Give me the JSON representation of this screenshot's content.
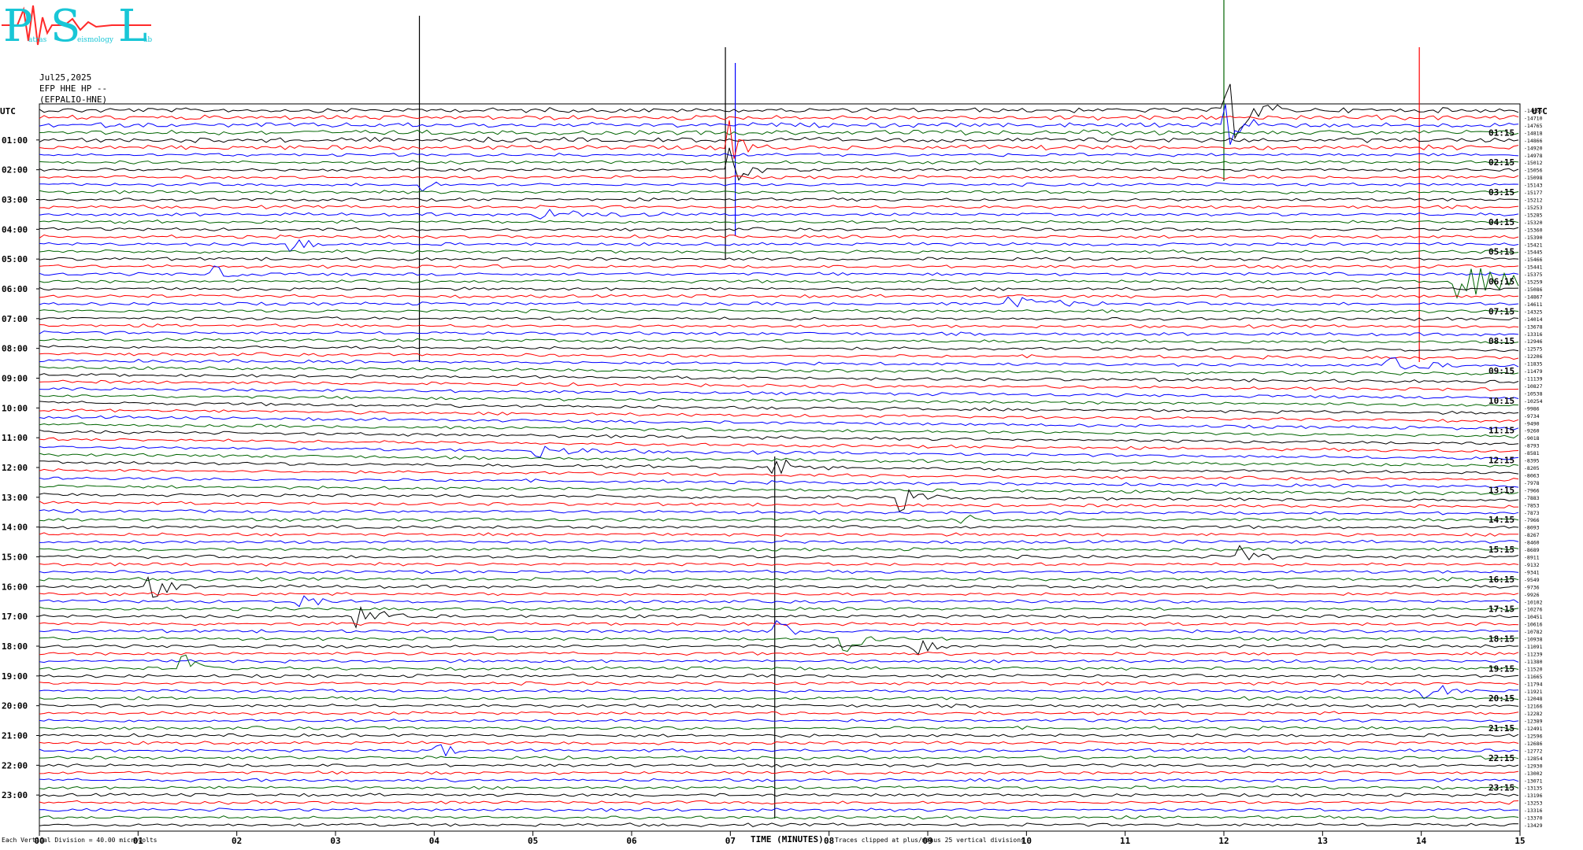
{
  "header": {
    "date": "Jul25,2025",
    "channel": "EFP HHE HP --",
    "station": "(EFPALIO-HNE)"
  },
  "logo": {
    "letters": [
      "P",
      "S",
      "L"
    ],
    "words": [
      "atras",
      "eismology",
      "ab"
    ]
  },
  "utc_label": "UTC",
  "footer": {
    "division": "Each Vertical Division =   40.00 microvolts",
    "xlabel": "TIME (MINUTES)",
    "clip": "Traces clipped at plus/minus 25 vertical divisions"
  },
  "colors": [
    "#000000",
    "#ff0000",
    "#0000ff",
    "#006400"
  ],
  "chart_data": {
    "type": "line",
    "title": "",
    "xlabel": "TIME (MINUTES)",
    "x_ticks": [
      "00",
      "01",
      "02",
      "03",
      "04",
      "05",
      "06",
      "07",
      "08",
      "09",
      "10",
      "11",
      "12",
      "13",
      "14",
      "15"
    ],
    "xlim": [
      0,
      15
    ],
    "left_hour_labels": [
      "01:00",
      "02:00",
      "03:00",
      "04:00",
      "05:00",
      "06:00",
      "07:00",
      "08:00",
      "09:00",
      "10:00",
      "11:00",
      "12:00",
      "13:00",
      "14:00",
      "15:00",
      "16:00",
      "17:00",
      "18:00",
      "19:00",
      "20:00",
      "21:00",
      "22:00",
      "23:00"
    ],
    "right_hour_labels": [
      "01:15",
      "02:15",
      "03:15",
      "04:15",
      "05:15",
      "06:15",
      "07:15",
      "08:15",
      "09:15",
      "10:15",
      "11:15",
      "12:15",
      "13:15",
      "14:15",
      "15:15",
      "16:15",
      "17:15",
      "18:15",
      "19:15",
      "20:15",
      "21:15",
      "22:15",
      "23:15"
    ],
    "trace_offsets": [
      -14655,
      -14710,
      -14765,
      -14818,
      -14866,
      -14920,
      -14978,
      -15012,
      -15056,
      -15098,
      -15143,
      -15177,
      -15212,
      -15253,
      -15285,
      -15320,
      -15360,
      -15390,
      -15421,
      -15445,
      -15466,
      -15441,
      -15375,
      -15259,
      -15086,
      -14867,
      -14611,
      -14325,
      -14014,
      -13678,
      -13316,
      -12946,
      -12575,
      -12206,
      -11835,
      -11479,
      -11139,
      -10827,
      -10538,
      -10254,
      -9986,
      -9734,
      -9490,
      -9260,
      -9018,
      -8793,
      -8581,
      -8395,
      -8205,
      -8063,
      -7978,
      -7966,
      -7883,
      -7853,
      -7873,
      -7966,
      -8093,
      -8267,
      -8460,
      -8689,
      -8911,
      -9132,
      -9341,
      -9549,
      -9736,
      -9926,
      -10102,
      -10276,
      -10451,
      -10616,
      -10782,
      -10938,
      -11091,
      -11239,
      -11380,
      -11520,
      -11665,
      -11794,
      -11921,
      -12048,
      -12166,
      -12282,
      -12389,
      -12491,
      -12596,
      -12686,
      -12772,
      -12854,
      -12930,
      -13002,
      -13071,
      -13135,
      -13196,
      -13253,
      -13316,
      -13370,
      -13429
    ],
    "trace_count": 97,
    "minutes_per_trace": 15,
    "vertical_division_microvolts": 40.0,
    "clip_divisions": 25
  }
}
